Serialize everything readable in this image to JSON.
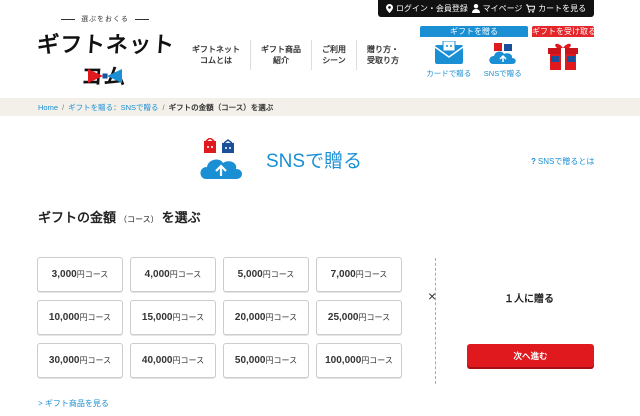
{
  "topbar": {
    "login": "ログイン・会員登録",
    "mypage": "マイページ",
    "cart": "カートを見る"
  },
  "logo": {
    "tagline": "選ぶをおくる",
    "name": "ギフトネットコム"
  },
  "nav": {
    "items": [
      "ギフトネット\nコムとは",
      "ギフト商品\n紹介",
      "ご利用\nシーン",
      "贈り方・\n受取り方"
    ]
  },
  "give": {
    "header": "ギフトを贈る",
    "card": "カードで贈る",
    "sns": "SNSで贈る"
  },
  "receive": {
    "header": "ギフトを受け取る"
  },
  "breadcrumb": {
    "home": "Home",
    "sns": "ギフトを贈る：SNSで贈る",
    "current": "ギフトの金額（コース）を選ぶ",
    "separator": "/"
  },
  "page": {
    "title": "SNSで贈る",
    "help": "SNSで贈るとは",
    "help_mark": "?"
  },
  "section": {
    "title_main": "ギフトの金額",
    "title_small": "（コース）",
    "title_end": "を選ぶ"
  },
  "courses": [
    {
      "amount": "3,000",
      "unit": "円コース"
    },
    {
      "amount": "4,000",
      "unit": "円コース"
    },
    {
      "amount": "5,000",
      "unit": "円コース"
    },
    {
      "amount": "7,000",
      "unit": "円コース"
    },
    {
      "amount": "10,000",
      "unit": "円コース"
    },
    {
      "amount": "15,000",
      "unit": "円コース"
    },
    {
      "amount": "20,000",
      "unit": "円コース"
    },
    {
      "amount": "25,000",
      "unit": "円コース"
    },
    {
      "amount": "30,000",
      "unit": "円コース"
    },
    {
      "amount": "40,000",
      "unit": "円コース"
    },
    {
      "amount": "50,000",
      "unit": "円コース"
    },
    {
      "amount": "100,000",
      "unit": "円コース"
    }
  ],
  "quantity": {
    "multiply": "×",
    "label": "１人に贈る"
  },
  "next_button": "次へ進む",
  "footer_link": "> ギフト商品を見る",
  "colors": {
    "brand_blue": "#1a8fd4",
    "brand_red": "#e0191f",
    "crumb_bg": "#f3f0ea"
  }
}
